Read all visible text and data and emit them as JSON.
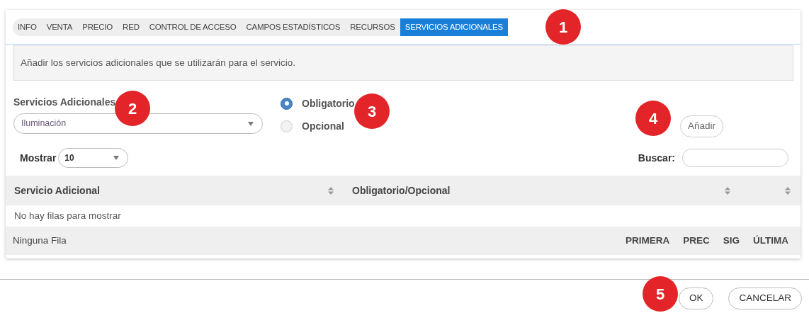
{
  "tabs": [
    {
      "label": "INFO",
      "selected": false
    },
    {
      "label": "VENTA",
      "selected": false
    },
    {
      "label": "PRECIO",
      "selected": false
    },
    {
      "label": "RED",
      "selected": false
    },
    {
      "label": "CONTROL DE ACCESO",
      "selected": false
    },
    {
      "label": "CAMPOS ESTADÍSTICOS",
      "selected": false
    },
    {
      "label": "RECURSOS",
      "selected": false
    },
    {
      "label": "SERVICIOS ADICIONALES",
      "selected": true
    }
  ],
  "info": "Añadir los servicios adicionales que se utilizarán para el servicio.",
  "service_select": {
    "label": "Servicios Adicionales",
    "value": "Iluminación"
  },
  "options": [
    {
      "label": "Obligatorio",
      "selected": true
    },
    {
      "label": "Opcional",
      "selected": false
    }
  ],
  "add_button": "Añadir",
  "show": {
    "label": "Mostrar",
    "value": "10"
  },
  "search": {
    "label": "Buscar:"
  },
  "table": {
    "columns": [
      {
        "label": "Servicio Adicional",
        "sortable": true
      },
      {
        "label": "Obligatorio/Opcional",
        "sortable": true
      },
      {
        "sortable": true
      }
    ],
    "empty": "No hay filas para mostrar"
  },
  "footer": {
    "info": "Ninguna Fila",
    "pages": [
      "PRIMERA",
      "PREC",
      "SIG",
      "ÚLTIMA"
    ]
  },
  "buttons": [
    "OK",
    "CANCELAR"
  ],
  "callouts": [
    "1",
    "2",
    "3",
    "4",
    "5"
  ]
}
